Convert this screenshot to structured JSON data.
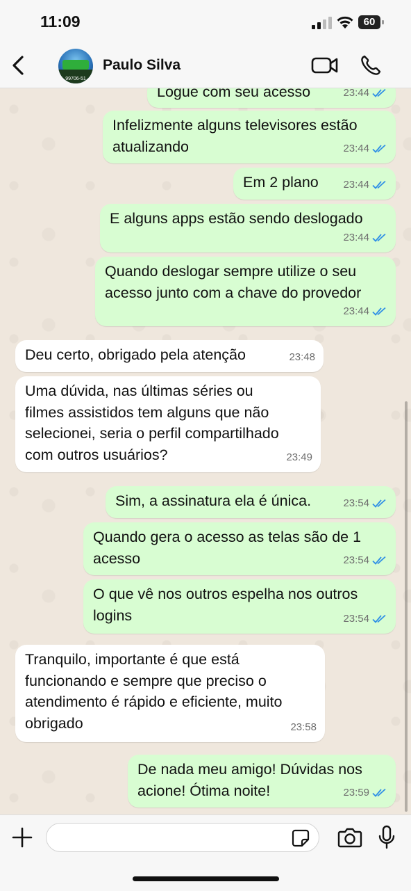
{
  "status_bar": {
    "time": "11:09",
    "battery": "60",
    "battery_level": 0.6
  },
  "header": {
    "contact_name": "Paulo Silva",
    "avatar_text": "99706-51"
  },
  "messages": [
    {
      "dir": "out",
      "text": "Logue com seu acesso",
      "time": "23:44",
      "read": true
    },
    {
      "dir": "out",
      "text": "Infelizmente alguns televisores estão\natualizando",
      "time": "23:44",
      "read": true
    },
    {
      "dir": "out",
      "text": "Em 2 plano",
      "time": "23:44",
      "read": true
    },
    {
      "dir": "out",
      "text": "E alguns apps estão sendo deslogado",
      "time": "23:44",
      "read": true
    },
    {
      "dir": "out",
      "text": "Quando deslogar sempre utilize o seu\nacesso junto com a chave do provedor",
      "time": "23:44",
      "read": true
    },
    {
      "dir": "in",
      "text": "Deu certo, obrigado pela atenção",
      "time": "23:48"
    },
    {
      "dir": "in",
      "text": "Uma dúvida, nas últimas séries ou\nfilmes assistidos tem alguns que não\nselecionei, seria o perfil compartilhado\ncom outros usuários?",
      "time": "23:49"
    },
    {
      "dir": "out",
      "text": "Sim, a assinatura ela é única.",
      "time": "23:54",
      "read": true
    },
    {
      "dir": "out",
      "text": "Quando gera o acesso as telas são de 1\nacesso",
      "time": "23:54",
      "read": true
    },
    {
      "dir": "out",
      "text": "O que vê nos outros espelha nos outros\nlogins",
      "time": "23:54",
      "read": true
    },
    {
      "dir": "in",
      "text": "Tranquilo, importante é que está\nfuncionando e sempre que preciso o\natendimento é rápido e eficiente, muito\nobrigado",
      "time": "23:58"
    },
    {
      "dir": "out",
      "text": "De nada meu amigo! Dúvidas nos\nacione! Ótima noite!",
      "time": "23:59",
      "read": true
    }
  ],
  "composer": {
    "value": "",
    "placeholder": ""
  },
  "colors": {
    "outgoing_bubble": "#d8fdd2",
    "incoming_bubble": "#ffffff",
    "read_ticks": "#2f8fe6",
    "chat_bg": "#efe7dd"
  },
  "icons": [
    "back-chevron-icon",
    "video-call-icon",
    "phone-icon",
    "plus-icon",
    "sticker-icon",
    "camera-icon",
    "microphone-icon",
    "double-check-icon"
  ]
}
